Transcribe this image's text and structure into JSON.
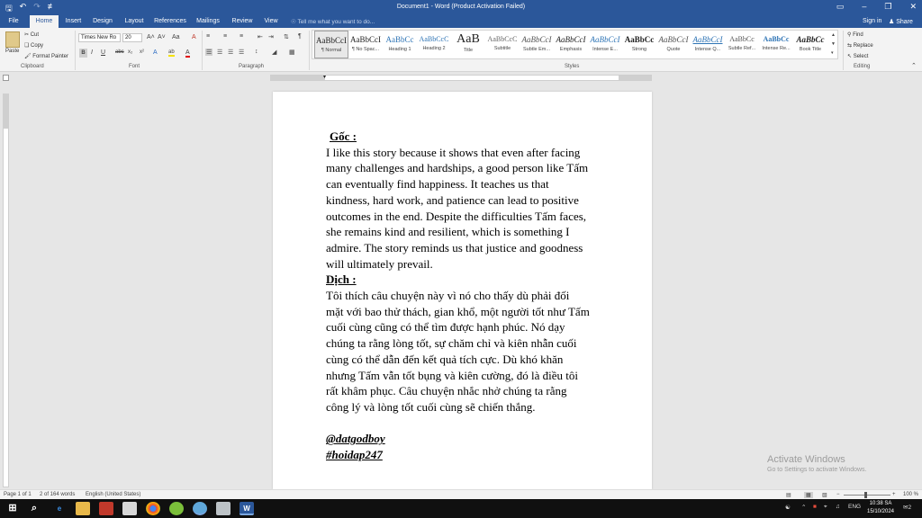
{
  "window": {
    "title": "Document1 - Word (Product Activation Failed)",
    "qat_save": "🖫",
    "qat_undo": "↶",
    "qat_redo": "↷",
    "qat_customize": "≢",
    "ctl_ribbon": "▭",
    "ctl_min": "–",
    "ctl_max": "❐",
    "ctl_close": "✕"
  },
  "tabs": [
    "File",
    "Home",
    "Insert",
    "Design",
    "Layout",
    "References",
    "Mailings",
    "Review",
    "View"
  ],
  "active_tab": "Home",
  "tell_me": "Tell me what you want to do...",
  "sign_in": "Sign in",
  "share": "Share",
  "clipboard": {
    "paste": "Paste",
    "cut": "Cut",
    "copy": "Copy",
    "format_painter": "Format Painter",
    "label": "Clipboard"
  },
  "font": {
    "name": "Times New Ro",
    "size": "20",
    "grow": "A˄",
    "shrink": "A˅",
    "case": "Aa",
    "clear": "A",
    "bold": "B",
    "italic": "I",
    "underline": "U",
    "strike": "abc",
    "subscript": "x₂",
    "superscript": "x²",
    "effects": "A",
    "highlight": "ab",
    "color": "A",
    "label": "Font"
  },
  "paragraph": {
    "label": "Paragraph",
    "pilcrow": "¶",
    "sort": "⇅"
  },
  "styles": {
    "label": "Styles",
    "items": [
      {
        "sample": "AaBbCcI",
        "name": "¶ Normal"
      },
      {
        "sample": "AaBbCcI",
        "name": "¶ No Spac..."
      },
      {
        "sample": "AaBbCc",
        "name": "Heading 1"
      },
      {
        "sample": "AaBbCcC",
        "name": "Heading 2"
      },
      {
        "sample": "AaB",
        "name": "Title"
      },
      {
        "sample": "AaBbCcC",
        "name": "Subtitle"
      },
      {
        "sample": "AaBbCcI",
        "name": "Subtle Em..."
      },
      {
        "sample": "AaBbCcI",
        "name": "Emphasis"
      },
      {
        "sample": "AaBbCcI",
        "name": "Intense E..."
      },
      {
        "sample": "AaBbCc",
        "name": "Strong"
      },
      {
        "sample": "AaBbCcI",
        "name": "Quote"
      },
      {
        "sample": "AaBbCcI",
        "name": "Intense Q..."
      },
      {
        "sample": "AaBbCc",
        "name": "Subtle Ref..."
      },
      {
        "sample": "AaBbCc",
        "name": "Intense Re..."
      },
      {
        "sample": "AaBbCc",
        "name": "Book Title"
      }
    ]
  },
  "editing": {
    "find": "Find",
    "replace": "Replace",
    "select": "Select",
    "label": "Editing"
  },
  "document": {
    "heading1": "Gốc :",
    "para1": [
      " I like this story because it shows that even after facing",
      "many challenges and hardships, a good person like Tấm",
      "can eventually find happiness. It teaches us that",
      "kindness, hard work, and patience can lead to positive",
      "outcomes in the end. Despite the difficulties Tấm faces,",
      "she remains kind and resilient, which is something I",
      "admire. The story reminds us that justice and goodness",
      "will ultimately prevail."
    ],
    "heading2": "Dịch :",
    "para2": [
      " Tôi thích câu chuyện này vì nó cho thấy dù phải đối",
      "mặt với bao thử thách, gian khổ, một người tốt như Tấm",
      "cuối cùng cũng có thể tìm được hạnh phúc. Nó dạy",
      "chúng ta rằng lòng tốt, sự chăm chỉ và kiên nhẫn cuối",
      "cùng có thể dẫn đến kết quả tích cực. Dù khó khăn",
      "nhưng Tấm vẫn tốt bụng và kiên cường, đó là điều tôi",
      "rất khâm phục. Câu chuyện nhắc nhở chúng ta rằng",
      "công lý và lòng tốt cuối cùng sẽ chiến thắng."
    ],
    "signature1": "@datgodboy",
    "signature2": "#hoidap247"
  },
  "watermark": {
    "line1": "Activate Windows",
    "line2": "Go to Settings to activate Windows."
  },
  "status": {
    "page": "Page 1 of 1",
    "words": "2 of 164 words",
    "language": "English (United States)",
    "zoom": "100 %"
  },
  "taskbar": {
    "start": "⊞",
    "search": "⌕",
    "lang": "ENG",
    "time": "10:38 SA",
    "date": "15/10/2024",
    "notif": "2"
  },
  "colors": {
    "word_blue": "#2b579a",
    "ribbon_bg": "#f3f3f3",
    "taskbar_bg": "#101010"
  }
}
